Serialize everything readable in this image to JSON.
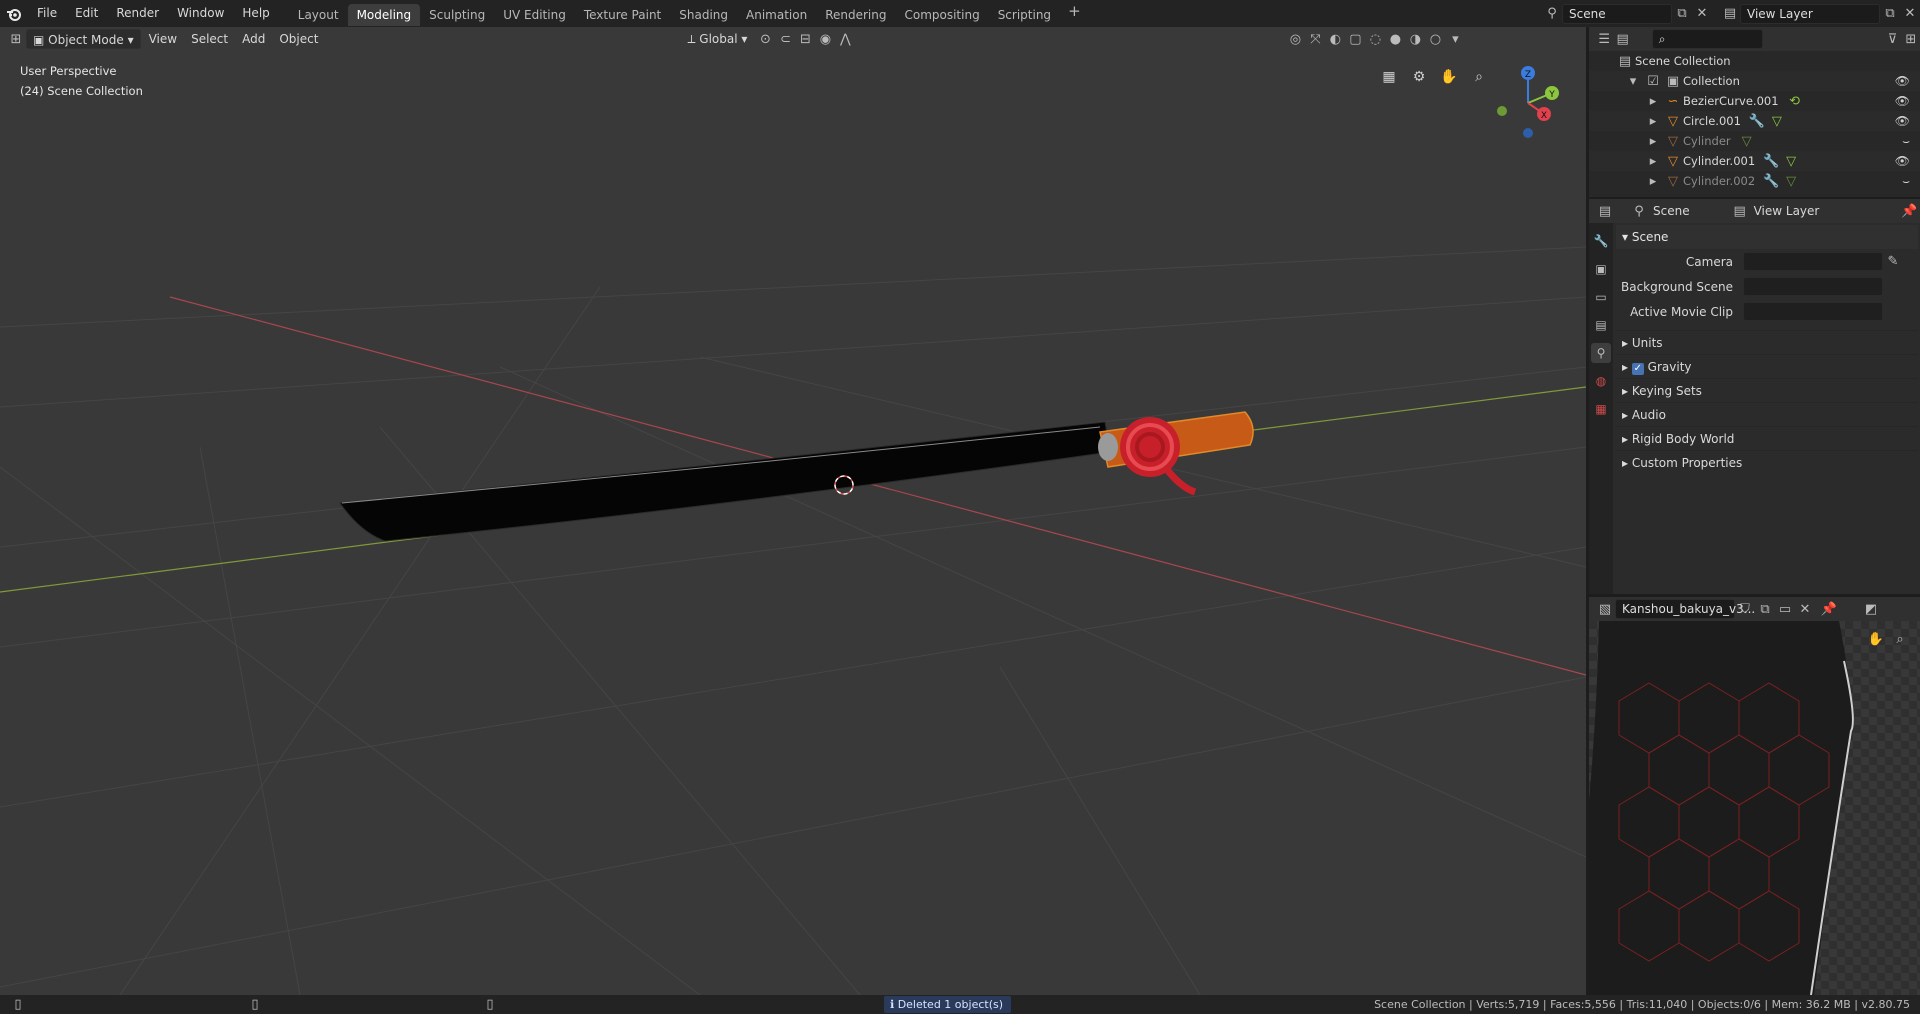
{
  "topbar": {
    "menus": [
      "File",
      "Edit",
      "Render",
      "Window",
      "Help"
    ],
    "workspaces": [
      "Layout",
      "Modeling",
      "Sculpting",
      "UV Editing",
      "Texture Paint",
      "Shading",
      "Animation",
      "Rendering",
      "Compositing",
      "Scripting"
    ],
    "active_workspace": "Modeling",
    "scene_name": "Scene",
    "view_layer": "View Layer"
  },
  "viewport": {
    "mode": "Object Mode",
    "menus": [
      "View",
      "Select",
      "Add",
      "Object"
    ],
    "transform_orientation": "Global",
    "info_line1": "User Perspective",
    "info_line2": "(24) Scene Collection",
    "gizmo_axes": [
      "Z",
      "Y",
      "X"
    ]
  },
  "outliner": {
    "root": "Scene Collection",
    "collection": "Collection",
    "items": [
      {
        "name": "BezierCurve.001",
        "dimmed": false
      },
      {
        "name": "Circle.001",
        "dimmed": false
      },
      {
        "name": "Cylinder",
        "dimmed": true
      },
      {
        "name": "Cylinder.001",
        "dimmed": false
      },
      {
        "name": "Cylinder.002",
        "dimmed": true
      }
    ]
  },
  "properties": {
    "header_scene": "Scene",
    "header_view_layer": "View Layer",
    "panel_title": "Scene",
    "fields": [
      {
        "label": "Camera"
      },
      {
        "label": "Background Scene"
      },
      {
        "label": "Active Movie Clip"
      }
    ],
    "subpanels": [
      "Units",
      "Gravity",
      "Keying Sets",
      "Audio",
      "Rigid Body World",
      "Custom Properties"
    ]
  },
  "image_editor": {
    "image_name": "Kanshou_bakuya_v3..."
  },
  "statusbar": {
    "message": "Deleted 1 object(s)",
    "stats": "Scene Collection | Verts:5,719 | Faces:5,556 | Tris:11,040 | Objects:0/6 | Mem: 36.2 MB | v2.80.75"
  },
  "colors": {
    "accent": "#4772b3",
    "x_axis": "#e0414d",
    "y_axis": "#8cc63e",
    "z_axis": "#3a7ce0",
    "object_orange": "#e08a2a"
  }
}
